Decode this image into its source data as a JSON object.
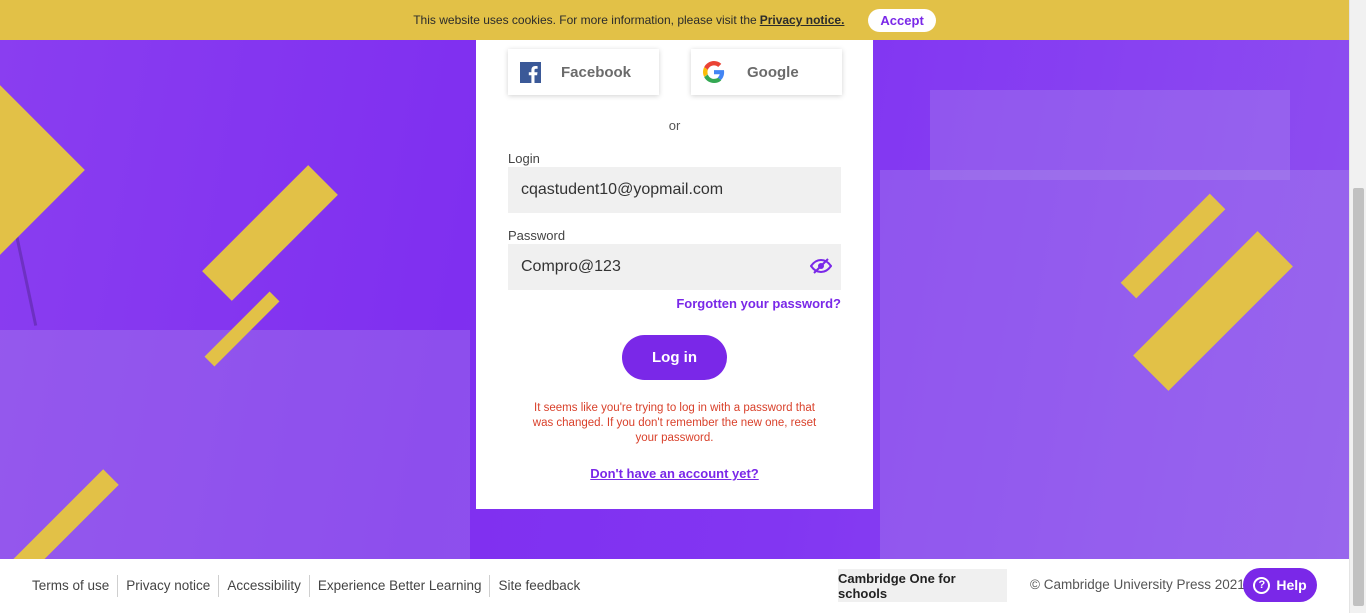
{
  "cookie_banner": {
    "message": "This website uses cookies. For more information, please visit the",
    "link_label": "Privacy notice.",
    "accept_label": "Accept"
  },
  "login_card": {
    "social": {
      "facebook_label": "Facebook",
      "google_label": "Google"
    },
    "or_text": "or",
    "login_label": "Login",
    "login_value": "cqastudent10@yopmail.com",
    "password_label": "Password",
    "password_value": "Compro@123",
    "forgot_label": "Forgotten your password?",
    "login_button": "Log in",
    "error_message": "It seems like you're trying to log in with a password that was changed. If you don't remember the new one, reset your password.",
    "signup_label": "Don't have an account yet?"
  },
  "footer": {
    "links": [
      "Terms of use",
      "Privacy notice",
      "Accessibility",
      "Experience Better Learning",
      "Site feedback"
    ],
    "schools_label": "Cambridge One for schools",
    "copyright": "© Cambridge University Press 2021",
    "help_label": "Help"
  },
  "icons": {
    "facebook": "facebook-icon",
    "google": "google-icon",
    "password_visibility": "eye-hidden-icon",
    "help": "question-circle-icon"
  },
  "colors": {
    "brand_purple": "#7a28e8",
    "accent_yellow": "#e2c147",
    "error_red": "#d9412b",
    "facebook_blue": "#3b5998"
  }
}
